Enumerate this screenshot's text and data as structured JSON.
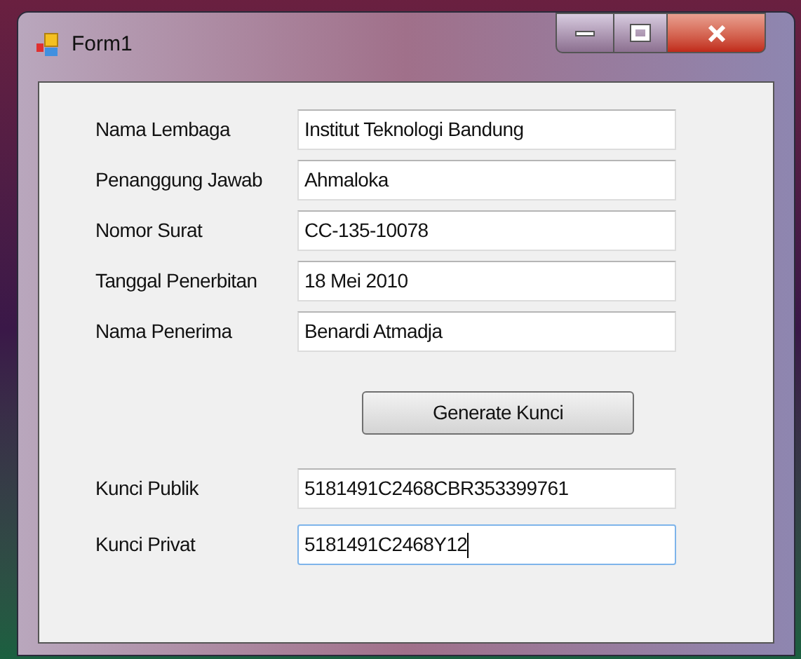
{
  "window": {
    "title": "Form1"
  },
  "fields": [
    {
      "label": "Nama Lembaga",
      "value": "Institut Teknologi Bandung",
      "focused": false
    },
    {
      "label": "Penanggung Jawab",
      "value": "Ahmaloka",
      "focused": false
    },
    {
      "label": "Nomor Surat",
      "value": "CC-135-10078",
      "focused": false
    },
    {
      "label": "Tanggal Penerbitan",
      "value": "18 Mei 2010",
      "focused": false
    },
    {
      "label": "Nama Penerima",
      "value": "Benardi Atmadja",
      "focused": false
    }
  ],
  "button": {
    "label": "Generate Kunci"
  },
  "keys": [
    {
      "label": "Kunci Publik",
      "value": "5181491C2468CBR353399761",
      "focused": false
    },
    {
      "label": "Kunci Privat",
      "value": "5181491C2468Y12",
      "focused": true
    }
  ]
}
